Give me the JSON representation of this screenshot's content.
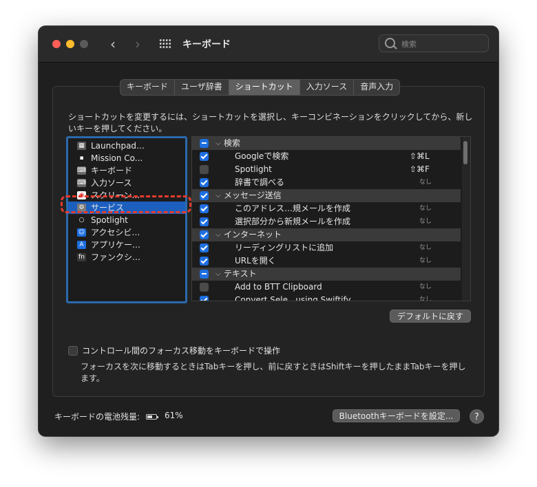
{
  "window": {
    "title": "キーボード"
  },
  "search": {
    "placeholder": "検索"
  },
  "tabs": [
    {
      "label": "キーボード",
      "active": false
    },
    {
      "label": "ユーザ辞書",
      "active": false
    },
    {
      "label": "ショートカット",
      "active": true
    },
    {
      "label": "入力ソース",
      "active": false
    },
    {
      "label": "音声入力",
      "active": false
    }
  ],
  "description": "ショートカットを変更するには、ショートカットを選択し、キーコンビネーションをクリックしてから、新しいキーを押してください。",
  "categories": [
    {
      "label": "Launchpad…",
      "icon": "launchpad-icon",
      "glyph": "▦",
      "color": "#5a5a5a"
    },
    {
      "label": "Mission Co...",
      "icon": "mission-control-icon",
      "glyph": "▪",
      "color": "#1c1c1c"
    },
    {
      "label": "キーボード",
      "icon": "keyboard-icon",
      "glyph": "⌨",
      "color": "#6a6a6a"
    },
    {
      "label": "入力ソース",
      "icon": "input-source-icon",
      "glyph": "⌨",
      "color": "#6a6a6a"
    },
    {
      "label": "スクリーン…",
      "icon": "screenshot-icon",
      "glyph": "◉",
      "color": "#ffffff"
    },
    {
      "label": "サービス",
      "icon": "services-gear-icon",
      "glyph": "⚙",
      "color": "#7a7a7a",
      "selected": true
    },
    {
      "label": "Spotlight",
      "icon": "spotlight-icon",
      "glyph": "○",
      "color": "#1c1c1c"
    },
    {
      "label": "アクセシビ…",
      "icon": "accessibility-icon",
      "glyph": "☺",
      "color": "#1e6fe0"
    },
    {
      "label": "アプリケー…",
      "icon": "app-store-icon",
      "glyph": "A",
      "color": "#1e6fe0"
    },
    {
      "label": "ファンクシ…",
      "icon": "fn-key-icon",
      "glyph": "fn",
      "color": "#3a3a3a"
    }
  ],
  "shortcuts": [
    {
      "type": "group",
      "label": "検索",
      "check": "mixed"
    },
    {
      "type": "item",
      "label": "Googleで検索",
      "check": "on",
      "key": "⇧⌘L"
    },
    {
      "type": "item",
      "label": "Spotlight",
      "check": "off",
      "key": "⇧⌘F"
    },
    {
      "type": "item",
      "label": "辞書で調べる",
      "check": "on",
      "key": "なし"
    },
    {
      "type": "group",
      "label": "メッセージ送信",
      "check": "on"
    },
    {
      "type": "item",
      "label": "このアドレス…規メールを作成",
      "check": "on",
      "key": "なし"
    },
    {
      "type": "item",
      "label": "選択部分から新規メールを作成",
      "check": "on",
      "key": "なし"
    },
    {
      "type": "group",
      "label": "インターネット",
      "check": "on"
    },
    {
      "type": "item",
      "label": "リーディングリストに追加",
      "check": "on",
      "key": "なし"
    },
    {
      "type": "item",
      "label": "URLを開く",
      "check": "on",
      "key": "なし"
    },
    {
      "type": "group",
      "label": "テキスト",
      "check": "mixed"
    },
    {
      "type": "item",
      "label": "Add to BTT Clipboard",
      "check": "off",
      "key": "なし"
    },
    {
      "type": "item",
      "label": "Convert Sele...using Swiftify",
      "check": "on",
      "key": "なし"
    }
  ],
  "buttons": {
    "restore_default": "デフォルトに戻す",
    "bluetooth": "Bluetoothキーボードを設定...",
    "help": "?"
  },
  "focus_checkbox": {
    "label": "コントロール間のフォーカス移動をキーボードで操作",
    "checked": false,
    "note": "フォーカスを次に移動するときはTabキーを押し、前に戻すときはShiftキーを押したままTabキーを押します。"
  },
  "battery": {
    "label": "キーボードの電池残量:",
    "value": "61%",
    "level": 0.61
  },
  "colors": {
    "accent": "#1e6fe0",
    "selection": "#1c5fbf",
    "highlight_dash": "#e83b2c"
  }
}
